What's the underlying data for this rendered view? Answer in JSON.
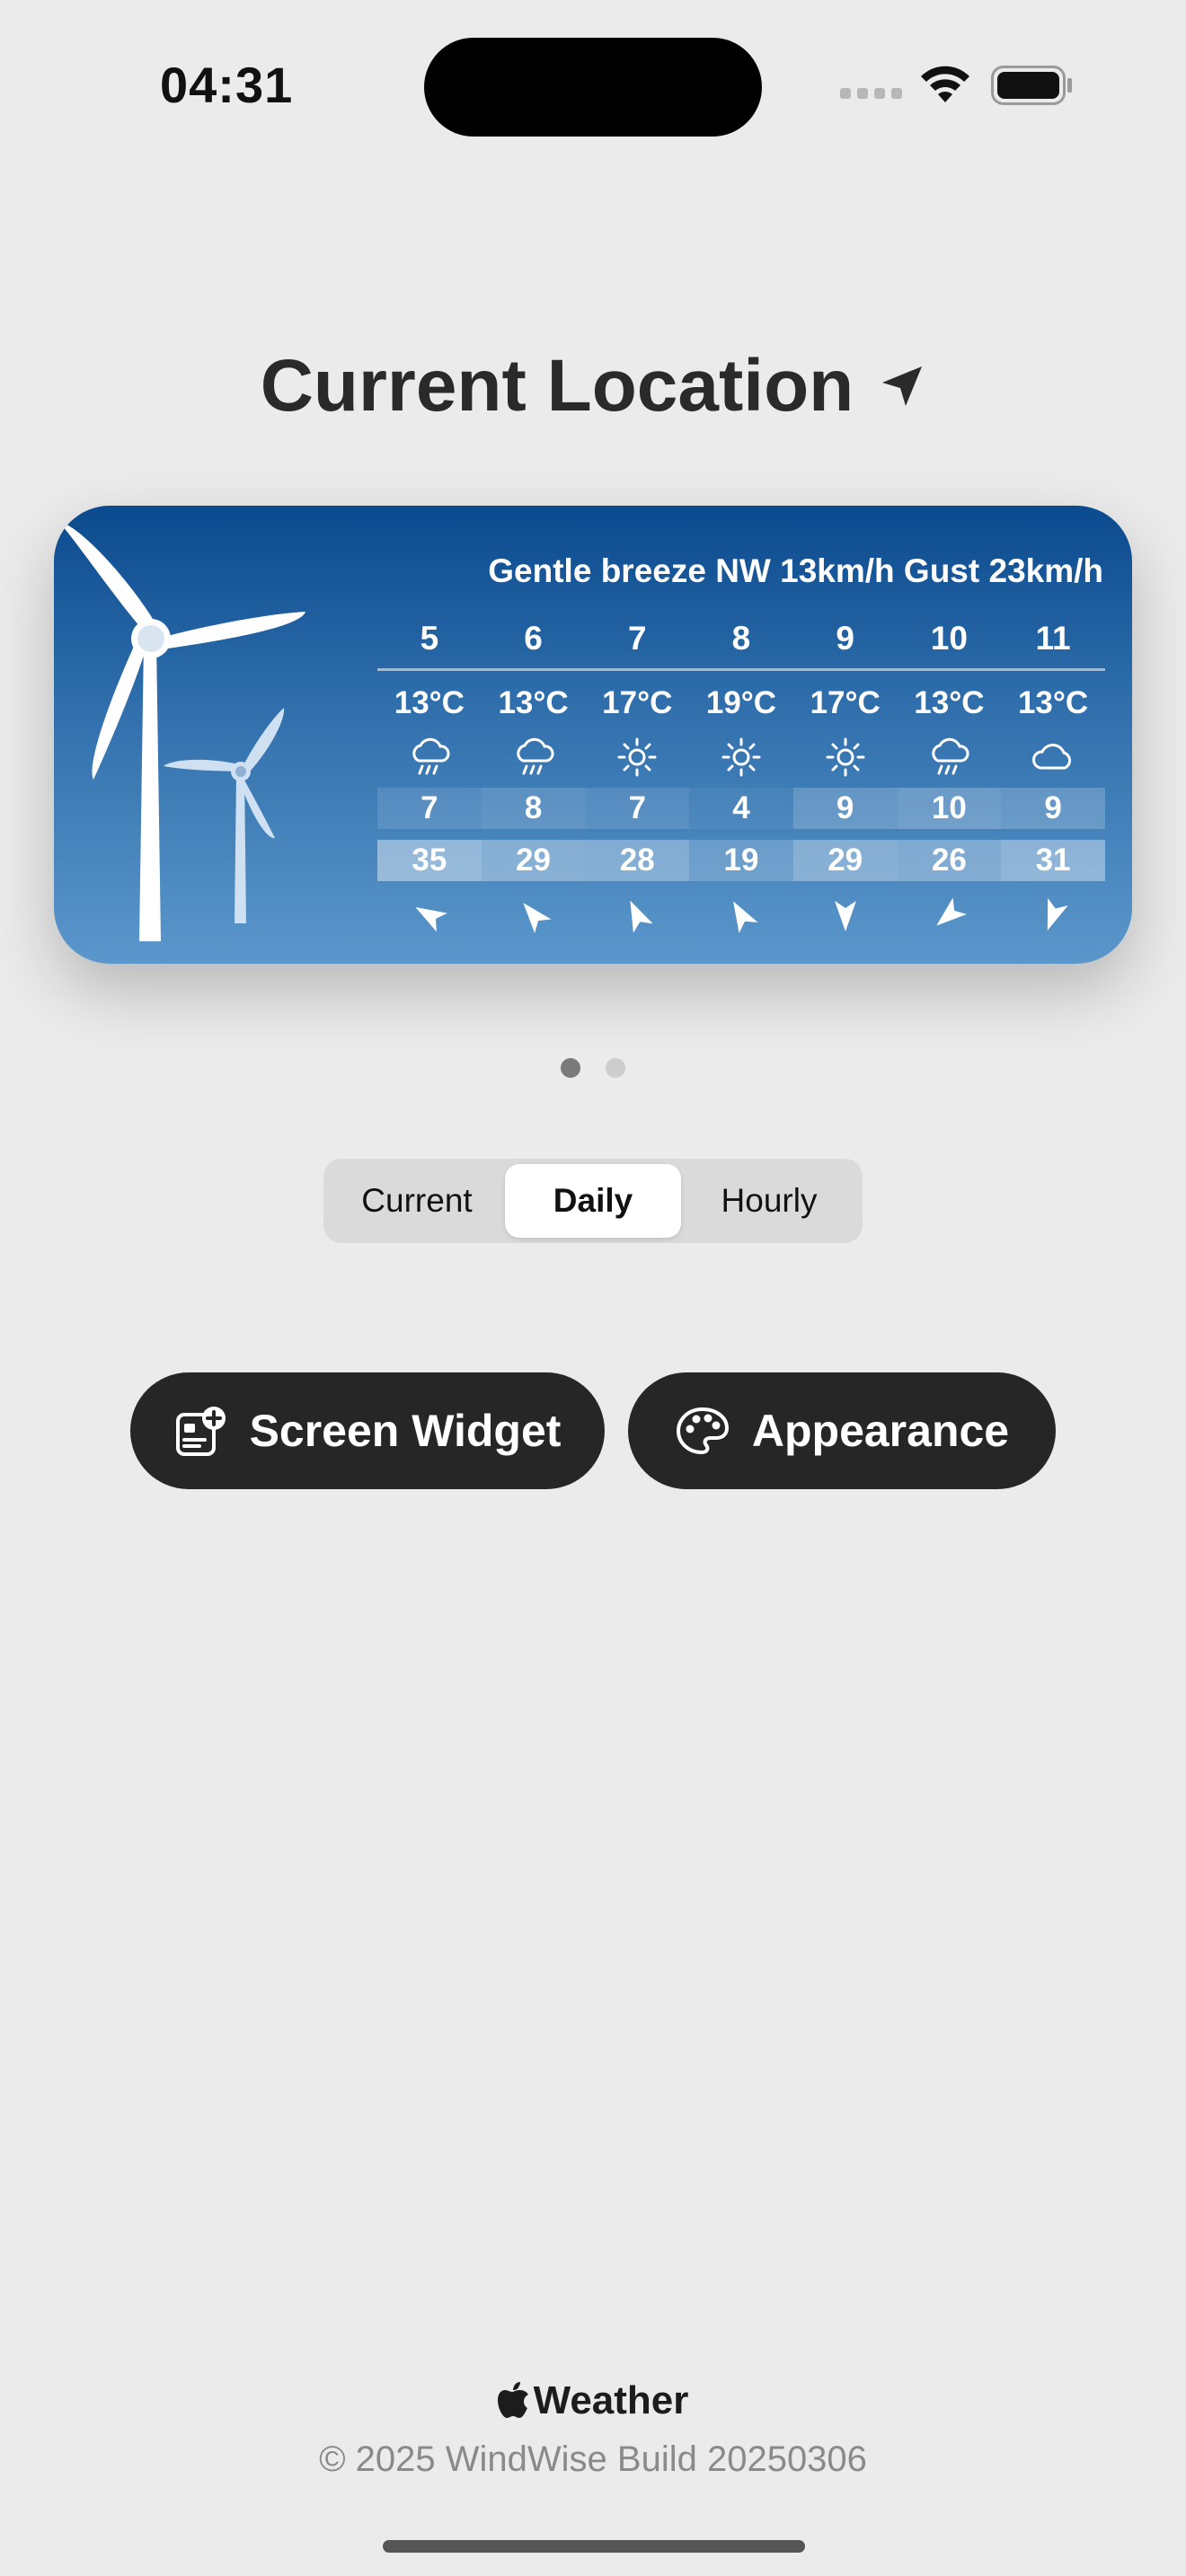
{
  "status_bar": {
    "time": "04:31"
  },
  "header": {
    "title": "Current Location",
    "location_icon": "location-arrow-icon"
  },
  "widget": {
    "headline": "Gentle breeze NW 13km/h Gust 23km/h",
    "days": [
      "5",
      "6",
      "7",
      "8",
      "9",
      "10",
      "11"
    ],
    "temps": [
      "13°C",
      "13°C",
      "17°C",
      "19°C",
      "17°C",
      "13°C",
      "13°C"
    ],
    "conditions": [
      "rain-icon",
      "rain-icon",
      "sun-icon",
      "sun-icon",
      "sun-icon",
      "rain-icon",
      "cloud-icon"
    ],
    "wind": [
      "7",
      "8",
      "7",
      "4",
      "9",
      "10",
      "9"
    ],
    "gust": [
      "35",
      "29",
      "28",
      "19",
      "29",
      "26",
      "31"
    ],
    "direction_icons": [
      "wind-arrow-icon",
      "wind-arrow-icon",
      "wind-arrow-icon",
      "wind-arrow-icon",
      "wind-arrow-icon",
      "wind-arrow-icon",
      "wind-arrow-icon"
    ],
    "colors": {
      "top": "#0a4a8e",
      "bottom": "#5b97cb"
    }
  },
  "pager": {
    "pages": 2,
    "active": 1
  },
  "segmented": {
    "options": [
      "Current",
      "Daily",
      "Hourly"
    ],
    "selected": "Daily"
  },
  "actions": {
    "widget_label": "Screen Widget",
    "appearance_label": "Appearance"
  },
  "footer": {
    "brand": "Weather",
    "copyright": "© 2025 WindWise Build 20250306"
  }
}
